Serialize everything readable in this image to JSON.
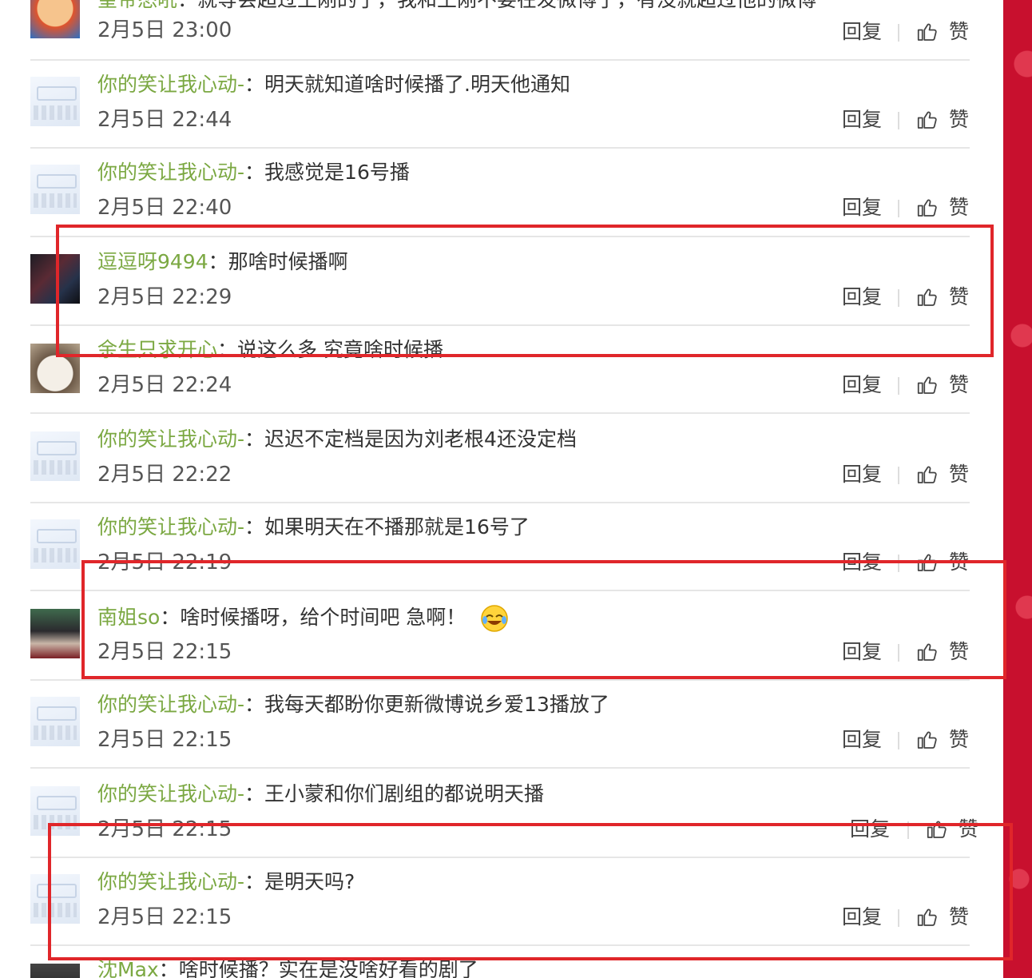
{
  "actions": {
    "reply_label": "回复",
    "like_label": "赞"
  },
  "comments": [
    {
      "username": "皇帝怒吼",
      "text": "就等会超过王刚的了，我和王刚不要在发微博了，有没就超过他的微博",
      "time": "2月5日 23:00",
      "avatar": "cartoon-avatar"
    },
    {
      "username": "你的笑让我心动-",
      "text": "明天就知道啥时候播了.明天他通知",
      "time": "2月5日 22:44",
      "avatar": "fan-avatar"
    },
    {
      "username": "你的笑让我心动-",
      "text": "我感觉是16号播",
      "time": "2月5日 22:40",
      "avatar": "fan-avatar"
    },
    {
      "username": "逗逗呀9494",
      "text": "那啥时候播啊",
      "time": "2月5日 22:29",
      "avatar": "dark-avatar"
    },
    {
      "username": "余生只求开心",
      "text": "说这么多 究竟啥时候播",
      "time": "2月5日 22:24",
      "avatar": "cat-avatar"
    },
    {
      "username": "你的笑让我心动-",
      "text": "迟迟不定档是因为刘老根4还没定档",
      "time": "2月5日 22:22",
      "avatar": "fan-avatar"
    },
    {
      "username": "你的笑让我心动-",
      "text": "如果明天在不播那就是16号了",
      "time": "2月5日 22:19",
      "avatar": "fan-avatar"
    },
    {
      "username": "南姐so",
      "text": "啥时候播呀，给个时间吧  急啊！",
      "time": "2月5日 22:15",
      "avatar": "girl-avatar",
      "emoji": "laughing-crying-emoji"
    },
    {
      "username": "你的笑让我心动-",
      "text": "我每天都盼你更新微博说乡爱13播放了",
      "time": "2月5日 22:15",
      "avatar": "fan-avatar"
    },
    {
      "username": "你的笑让我心动-",
      "text": "王小蒙和你们剧组的都说明天播",
      "time": "2月5日 22:15",
      "avatar": "fan-avatar"
    },
    {
      "username": "你的笑让我心动-",
      "text": "是明天吗?",
      "time": "2月5日 22:15",
      "avatar": "fan-avatar"
    },
    {
      "username": "沈Max",
      "text": "啥时候播？实在是没啥好看的剧了",
      "time": "",
      "avatar": "dim-avatar"
    }
  ],
  "colors": {
    "username": "#7ba842",
    "highlight_border": "#e0262a",
    "side_background": "#c8102e"
  }
}
